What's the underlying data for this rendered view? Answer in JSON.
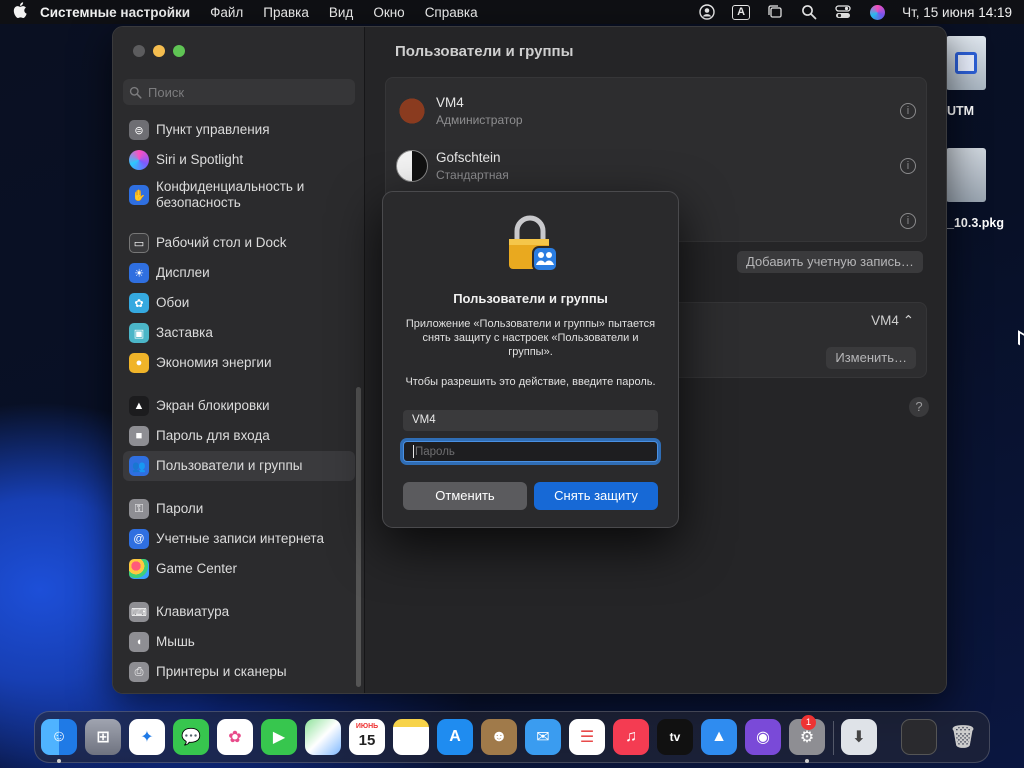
{
  "menubar": {
    "app_name": "Системные настройки",
    "menus": [
      "Файл",
      "Правка",
      "Вид",
      "Окно",
      "Справка"
    ],
    "input_source": "A",
    "datetime": "Чт, 15 июня  14:19"
  },
  "sidebar": {
    "search_placeholder": "Поиск",
    "items": [
      {
        "label": "Пункт управления",
        "icon": "control-center-icon",
        "color": "#6e6e73"
      },
      {
        "label": "Siri и Spotlight",
        "icon": "siri-icon",
        "color": "#b44ad8"
      },
      {
        "label": "Конфиденциальность и безопасность",
        "icon": "privacy-hand-icon",
        "color": "#2f6fe0"
      },
      {
        "label": "Рабочий стол и Dock",
        "icon": "desktop-dock-icon",
        "color": "#3a3a3c"
      },
      {
        "label": "Дисплеи",
        "icon": "display-icon",
        "color": "#2f6fe0"
      },
      {
        "label": "Обои",
        "icon": "wallpaper-icon",
        "color": "#35a9e0"
      },
      {
        "label": "Заставка",
        "icon": "screensaver-icon",
        "color": "#4bb6c8"
      },
      {
        "label": "Экономия энергии",
        "icon": "energy-icon",
        "color": "#f0b429"
      },
      {
        "label": "Экран блокировки",
        "icon": "lock-screen-icon",
        "color": "#1c1c1e"
      },
      {
        "label": "Пароль для входа",
        "icon": "login-password-icon",
        "color": "#8e8e93"
      },
      {
        "label": "Пользователи и группы",
        "icon": "users-groups-icon",
        "color": "#2f6fe0"
      },
      {
        "label": "Пароли",
        "icon": "passwords-key-icon",
        "color": "#8e8e93"
      },
      {
        "label": "Учетные записи интернета",
        "icon": "internet-accounts-icon",
        "color": "#2f6fe0"
      },
      {
        "label": "Game Center",
        "icon": "game-center-icon",
        "color": "#e0e0e0"
      },
      {
        "label": "Клавиатура",
        "icon": "keyboard-icon",
        "color": "#8e8e93"
      },
      {
        "label": "Мышь",
        "icon": "mouse-icon",
        "color": "#8e8e93"
      },
      {
        "label": "Принтеры и сканеры",
        "icon": "printer-icon",
        "color": "#8e8e93"
      }
    ]
  },
  "content": {
    "title": "Пользователи и группы",
    "users": [
      {
        "name": "VM4",
        "role": "Администратор"
      },
      {
        "name": "Gofschtein",
        "role": "Стандартная"
      }
    ],
    "add_account_label": "Добавить учетную запись…",
    "auto_login_value": "VM4",
    "change_label": "Изменить…",
    "help_label": "?"
  },
  "dialog": {
    "title": "Пользователи и группы",
    "message": "Приложение «Пользователи и группы» пытается снять защиту с настроек «Пользователи и группы».",
    "prompt": "Чтобы разрешить это действие, введите пароль.",
    "username_value": "VM4",
    "password_placeholder": "Пароль",
    "cancel_label": "Отменить",
    "unlock_label": "Снять защиту"
  },
  "desktop": {
    "utm_label": "UTM",
    "pkg_label": "_10.3.pkg"
  },
  "dock": {
    "calendar_month": "ИЮНЬ",
    "calendar_day": "15",
    "settings_badge": "1",
    "tv_label": "tv"
  }
}
